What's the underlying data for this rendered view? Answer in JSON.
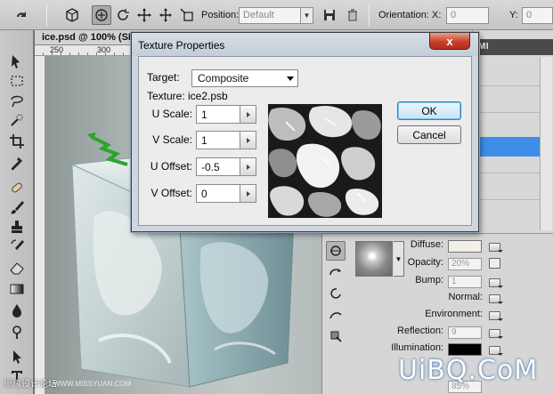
{
  "options_bar": {
    "position_label": "Position:",
    "position_value": "Default",
    "orientation_label": "Orientation:",
    "x_label": "X:",
    "x_value": "0",
    "y_label": "Y:",
    "y_value": "0"
  },
  "document": {
    "tab_label": "ice.psd @ 100% (SI",
    "ruler_marks": [
      "250",
      "300"
    ]
  },
  "panels": {
    "top_tab_label": "MI"
  },
  "materials": {
    "diffuse_label": "Diffuse:",
    "diffuse_color": "#f2f0e6",
    "opacity_label": "Opacity:",
    "opacity_value": "20%",
    "bump_label": "Bump:",
    "bump_value": "1",
    "normal_label": "Normal:",
    "environment_label": "Environment:",
    "reflection_label": "Reflection:",
    "reflection_value": "9",
    "illumination_label": "Illumination:",
    "illumination_color": "#000000",
    "bottom_value": "85%"
  },
  "dialog": {
    "title": "Texture Properties",
    "close_symbol": "x",
    "target_label": "Target:",
    "target_value": "Composite",
    "texture_label": "Texture: ice2.psb",
    "u_scale_label": "U Scale:",
    "u_scale_value": "1",
    "v_scale_label": "V Scale:",
    "v_scale_value": "1",
    "u_offset_label": "U Offset:",
    "u_offset_value": "-0.5",
    "v_offset_label": "V Offset:",
    "v_offset_value": "0",
    "ok_label": "OK",
    "cancel_label": "Cancel"
  },
  "watermarks": {
    "left_text": "思缘设计论坛",
    "mid_text": "WWW.MISSYUAN.COM",
    "right_text": "UiBQ.CoM"
  }
}
